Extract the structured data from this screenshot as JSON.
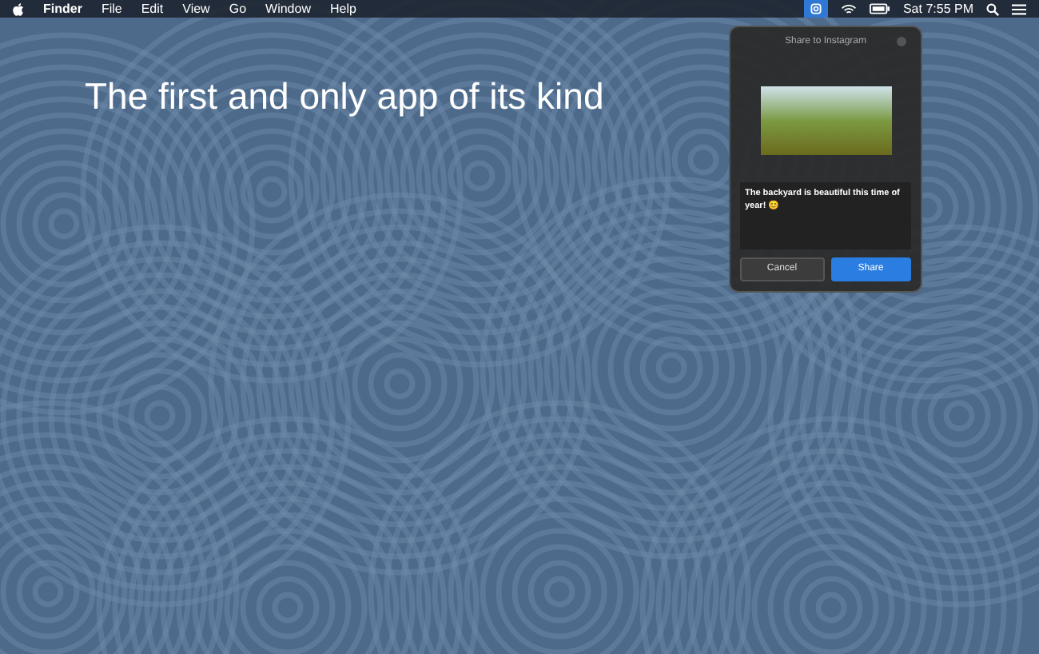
{
  "menu_bar": {
    "app_name": "Finder",
    "menus": [
      "File",
      "Edit",
      "View",
      "Go",
      "Window",
      "Help"
    ],
    "status_item_selected": true,
    "clock": "Sat 7:55 PM"
  },
  "headline": "The first and only app of its kind",
  "popover": {
    "title": "Share to Instagram",
    "caption": "The backyard is beautiful this time of year! 😊",
    "buttons": [
      {
        "label": "Cancel",
        "kind": "secondary"
      },
      {
        "label": "Share",
        "kind": "primary"
      }
    ]
  }
}
